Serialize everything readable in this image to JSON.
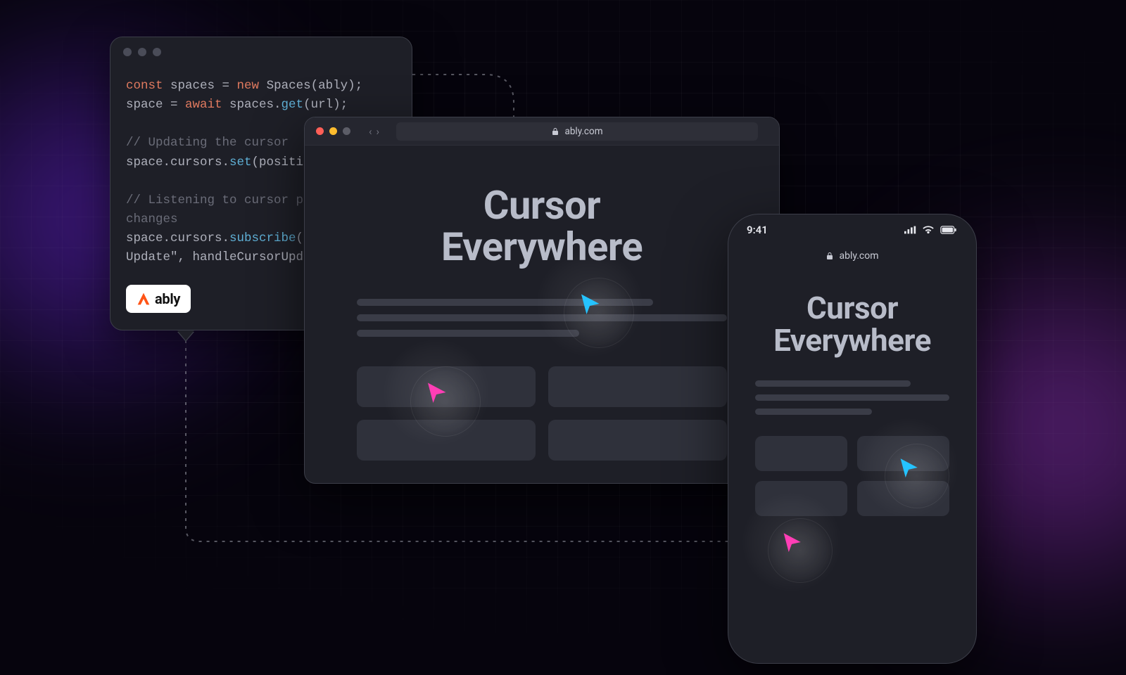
{
  "editor": {
    "badge": "ably",
    "code": {
      "l1_kw1": "const",
      "l1_mid": " spaces = ",
      "l1_kw2": "new",
      "l1_tail": " Spaces(ably);",
      "l2_pre": "space = ",
      "l2_kw": "await",
      "l2_mid": " spaces.",
      "l2_fn": "get",
      "l2_tail": "(url);",
      "c1": "// Updating the cursor",
      "l3_pre": "space.cursors.",
      "l3_fn": "set",
      "l3_tail": "(position);",
      "c2": "// Listening to cursor position changes",
      "l4_pre": "space.cursors.",
      "l4_fn": "subscribe",
      "l4_mid": "(\"cursors",
      "l5_pre": "Update\", handleCursorUpdate);"
    }
  },
  "browser": {
    "url": "ably.com",
    "heading_line1": "Cursor",
    "heading_line2": "Everywhere"
  },
  "phone": {
    "time": "9:41",
    "url": "ably.com",
    "heading_line1": "Cursor",
    "heading_line2": "Everywhere"
  },
  "colors": {
    "cursor_blue": "#25c3ff",
    "cursor_pink": "#ff3eb5"
  }
}
